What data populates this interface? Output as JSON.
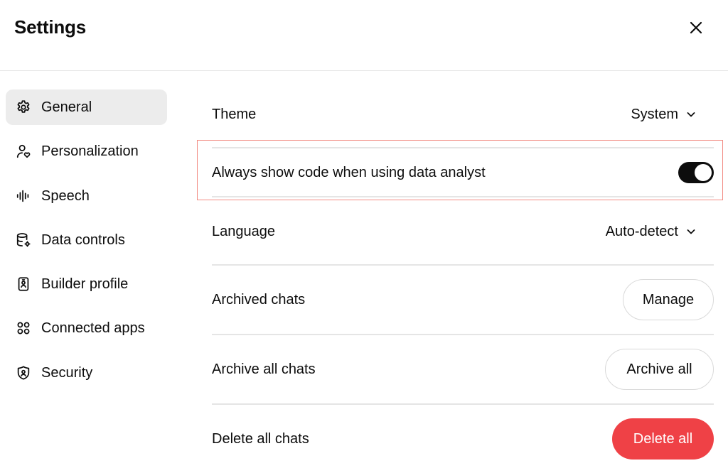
{
  "header": {
    "title": "Settings"
  },
  "sidebar": {
    "items": [
      {
        "label": "General",
        "icon": "gear-icon",
        "active": true
      },
      {
        "label": "Personalization",
        "icon": "person-heart-icon",
        "active": false
      },
      {
        "label": "Speech",
        "icon": "waveform-icon",
        "active": false
      },
      {
        "label": "Data controls",
        "icon": "database-gear-icon",
        "active": false
      },
      {
        "label": "Builder profile",
        "icon": "id-badge-icon",
        "active": false
      },
      {
        "label": "Connected apps",
        "icon": "apps-grid-icon",
        "active": false
      },
      {
        "label": "Security",
        "icon": "shield-lock-icon",
        "active": false
      }
    ]
  },
  "settings": {
    "theme": {
      "label": "Theme",
      "value": "System"
    },
    "code": {
      "label": "Always show code when using data analyst",
      "enabled": true
    },
    "language": {
      "label": "Language",
      "value": "Auto-detect"
    },
    "archived": {
      "label": "Archived chats",
      "button": "Manage"
    },
    "archive_all": {
      "label": "Archive all chats",
      "button": "Archive all"
    },
    "delete_all": {
      "label": "Delete all chats",
      "button": "Delete all"
    }
  },
  "colors": {
    "danger": "#ef4146",
    "toggle_on": "#0d0d0d",
    "active_item_bg": "#ececec",
    "highlight": "#f28b82"
  }
}
